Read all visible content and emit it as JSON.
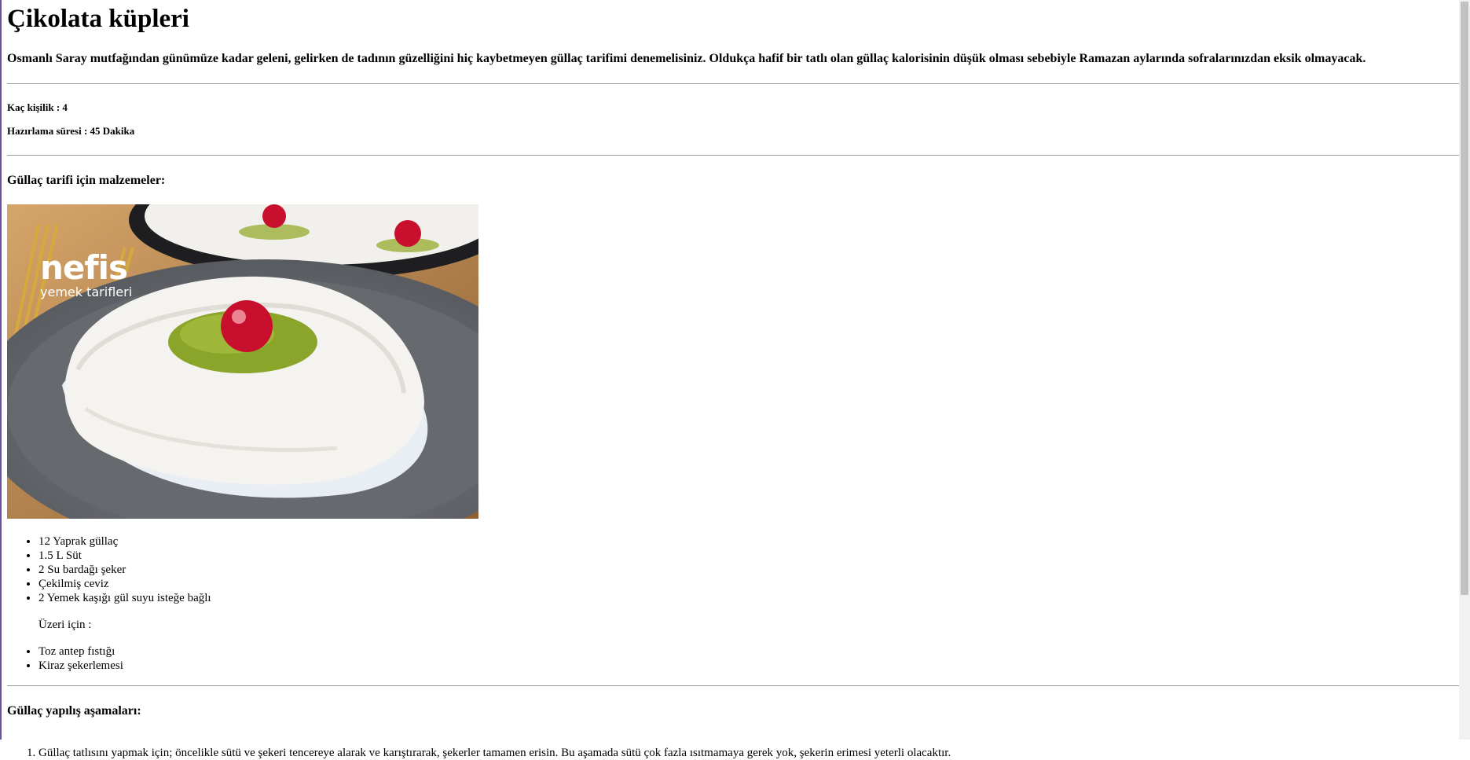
{
  "page": {
    "title": "Çikolata küpleri",
    "intro": "Osmanlı Saray mutfağından günümüze kadar geleni, gelirken de tadının güzelliğini hiç kaybetmeyen güllaç tarifimi denemelisiniz. Oldukça hafif bir tatlı olan güllaç kalorisinin düşük olması sebebiyle Ramazan aylarında sofralarınızdan eksik olmayacak.",
    "servings": "Kaç kişilik : 4",
    "prep_time": "Hazırlama süresi : 45 Dakika",
    "ingredients_heading": "Güllaç tarifi için malzemeler:",
    "image": {
      "watermark_brand": "nefis",
      "watermark_sub": "yemek tarifleri",
      "icon": "gullac-dessert-photo"
    },
    "ingredients": [
      "12 Yaprak güllaç",
      "1.5 L Süt",
      "2 Su bardağı şeker",
      "Çekilmiş ceviz",
      "2 Yemek kaşığı gül suyu isteğe bağlı"
    ],
    "topping_label": "Üzeri için :",
    "toppings": [
      "Toz antep fıstığı",
      "Kiraz şekerlemesi"
    ],
    "steps_heading": "Güllaç yapılış aşamaları:",
    "steps": [
      "Güllaç tatlısını yapmak için; öncelikle sütü ve şekeri tencereye alarak ve karıştırarak, şekerler tamamen erisin. Bu aşamada sütü çok fazla ısıtmamaya gerek yok, şekerin erimesi yeterli olacaktır."
    ]
  },
  "colors": {
    "divider": "#9a9a9a",
    "frame_accent": "#6a4fa3",
    "pistachio": "#8aa52a",
    "cherry": "#c8102e"
  }
}
